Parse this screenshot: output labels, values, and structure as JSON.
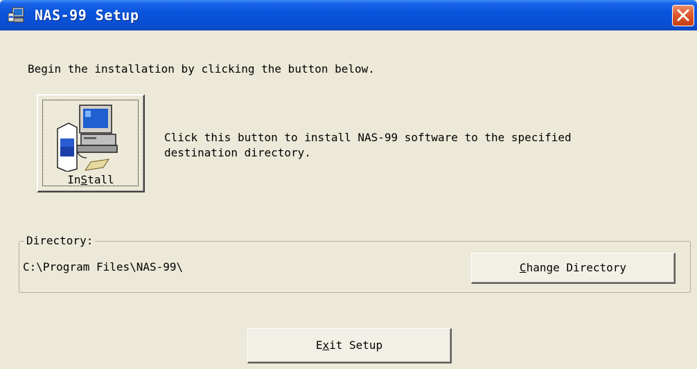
{
  "window": {
    "title": "NAS-99 Setup",
    "title_icon": "setup-computer-icon",
    "close_icon": "close-icon",
    "colors": {
      "titlebar": "#0a55dc",
      "close": "#dd5a2e",
      "background": "#ece9d8"
    }
  },
  "intro_text": "Begin the installation by clicking the button below.",
  "install": {
    "label_pre": "In",
    "label_accel": "S",
    "label_post": "tall",
    "description_line1": "Click this button to install NAS-99 software to the specified",
    "description_line2": "destination directory.",
    "icon": "install-computer-icon"
  },
  "directory": {
    "legend": "Directory:",
    "path": "C:\\Program Files\\NAS-99\\",
    "change_accel": "C",
    "change_rest": "hange Directory"
  },
  "exit": {
    "label_pre": "E",
    "label_accel": "x",
    "label_post": "it Setup"
  }
}
